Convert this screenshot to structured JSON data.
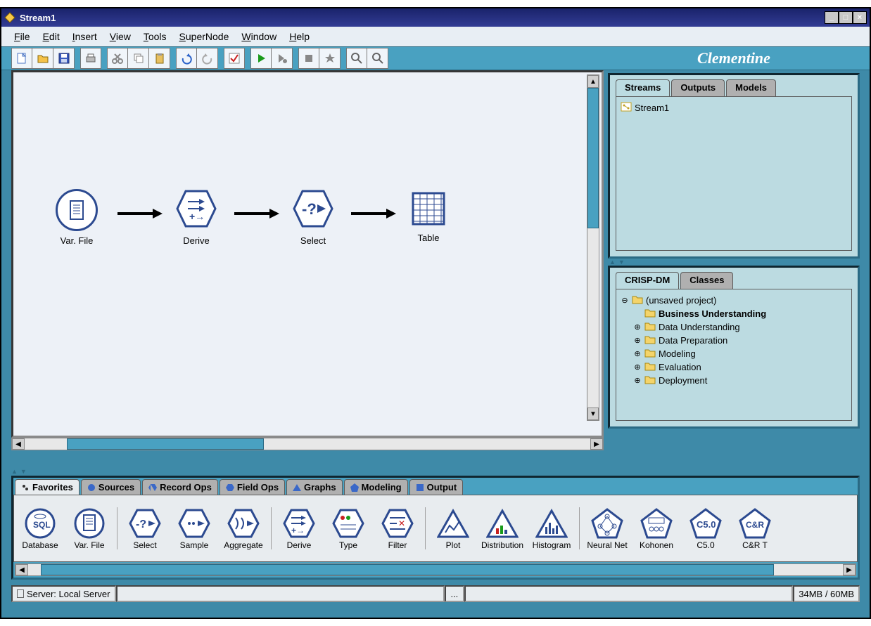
{
  "window": {
    "title": "Stream1"
  },
  "menu": {
    "file": "File",
    "edit": "Edit",
    "insert": "Insert",
    "view": "View",
    "tools": "Tools",
    "supernode": "SuperNode",
    "window": "Window",
    "help": "Help"
  },
  "brand": "Clementine",
  "canvas": {
    "nodes": [
      {
        "label": "Var. File"
      },
      {
        "label": "Derive"
      },
      {
        "label": "Select"
      },
      {
        "label": "Table"
      }
    ]
  },
  "rightTop": {
    "tabs": {
      "streams": "Streams",
      "outputs": "Outputs",
      "models": "Models"
    },
    "items": [
      "Stream1"
    ]
  },
  "rightBottom": {
    "tabs": {
      "crisp": "CRISP-DM",
      "classes": "Classes"
    },
    "root": "(unsaved project)",
    "phases": [
      "Business Understanding",
      "Data Understanding",
      "Data Preparation",
      "Modeling",
      "Evaluation",
      "Deployment"
    ]
  },
  "palette": {
    "tabs": {
      "favorites": "Favorites",
      "sources": "Sources",
      "recordops": "Record Ops",
      "fieldops": "Field Ops",
      "graphs": "Graphs",
      "modeling": "Modeling",
      "output": "Output"
    },
    "items": [
      "Database",
      "Var. File",
      "Select",
      "Sample",
      "Aggregate",
      "Derive",
      "Type",
      "Filter",
      "Plot",
      "Distribution",
      "Histogram",
      "Neural Net",
      "Kohonen",
      "C5.0",
      "C&R T"
    ]
  },
  "status": {
    "server": "Server: Local Server",
    "dots": "...",
    "memory": "34MB / 60MB"
  },
  "toolbar": [
    "new",
    "open",
    "save",
    "print",
    "cut",
    "copy",
    "paste",
    "undo",
    "redo",
    "check",
    "run",
    "run-selection",
    "stop",
    "star",
    "zoom-in",
    "zoom-out"
  ]
}
